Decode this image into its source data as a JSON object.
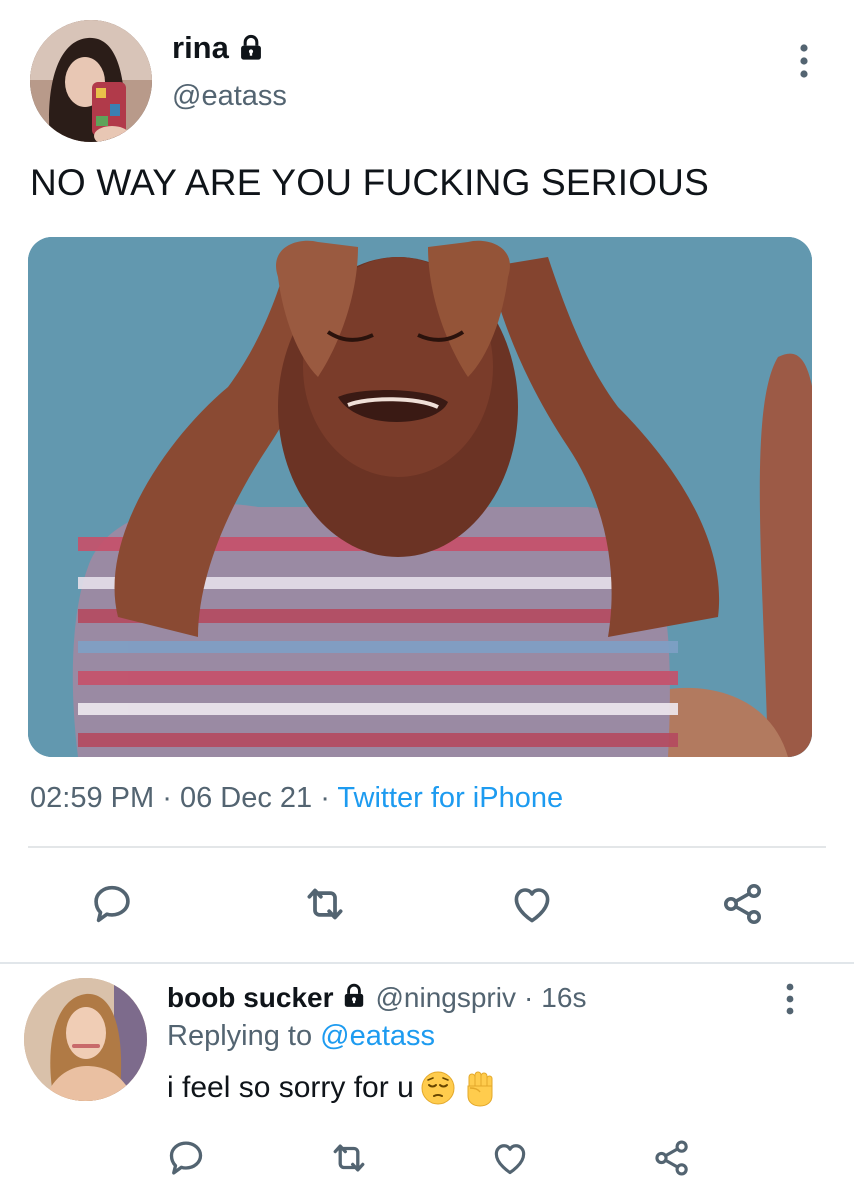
{
  "tweet": {
    "author_name": "rina",
    "author_handle": "@eatass",
    "text": "NO WAY ARE YOU FUCKING SERIOUS",
    "time": "02:59 PM",
    "date": "06 Dec 21",
    "source": "Twitter for iPhone",
    "separator": "·"
  },
  "reply": {
    "author_name": "boob sucker",
    "author_handle": "@ningspriv",
    "age": "16s",
    "separator": "·",
    "replying_prefix": "Replying to",
    "replying_to": "@eatass",
    "text": "i feel so sorry for u"
  },
  "icons": {
    "lock": "lock-icon",
    "more": "more-vertical-icon",
    "reply": "comment-icon",
    "retweet": "retweet-icon",
    "like": "heart-icon",
    "share": "share-icon",
    "emoji_1": "pensive-face-emoji",
    "emoji_2": "raised-fist-emoji"
  },
  "colors": {
    "accent": "#1d9bf0",
    "secondary_text": "#536471",
    "icon": "#536471"
  }
}
